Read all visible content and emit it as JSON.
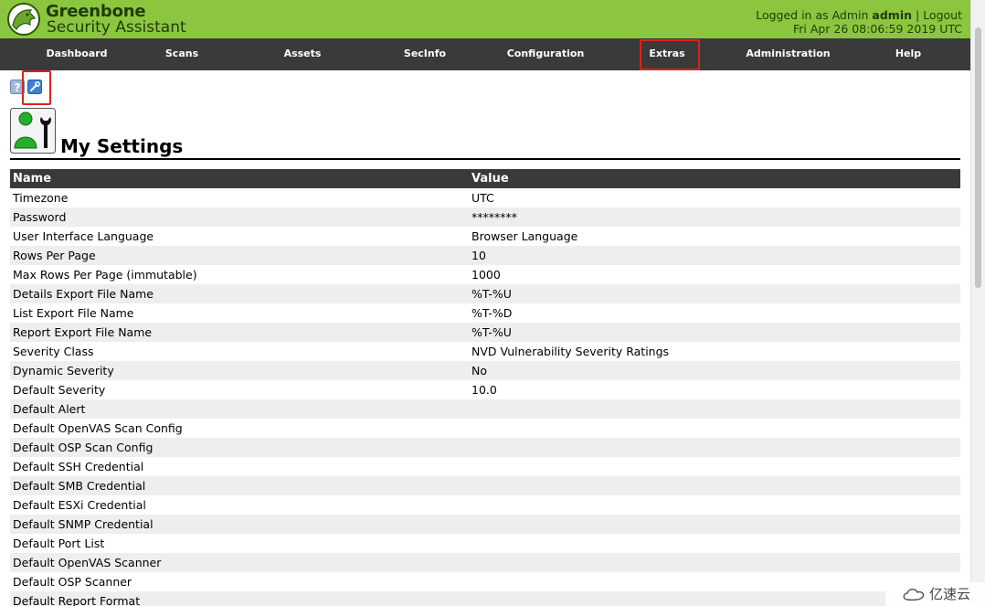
{
  "header": {
    "brand_line1": "Greenbone",
    "brand_line2": "Security Assistant",
    "logged_in_as": "Logged in as  Admin ",
    "username": "admin",
    "logout": "Logout",
    "separator": "|",
    "datetime": "Fri Apr 26 08:06:59 2019 UTC"
  },
  "nav": {
    "items": [
      {
        "label": "Dashboard"
      },
      {
        "label": "Scans"
      },
      {
        "label": "Assets"
      },
      {
        "label": "SecInfo"
      },
      {
        "label": "Configuration"
      },
      {
        "label": "Extras"
      },
      {
        "label": "Administration"
      },
      {
        "label": "Help"
      }
    ]
  },
  "toolbar": {
    "icons": [
      "help-icon",
      "edit-wrench-icon"
    ]
  },
  "page": {
    "title": "My Settings"
  },
  "table": {
    "headers": {
      "name": "Name",
      "value": "Value"
    },
    "rows": [
      {
        "name": "Timezone",
        "value": "UTC"
      },
      {
        "name": "Password",
        "value": "********"
      },
      {
        "name": "User Interface Language",
        "value": "Browser Language"
      },
      {
        "name": "Rows Per Page",
        "value": "10"
      },
      {
        "name": "Max Rows Per Page (immutable)",
        "value": "1000"
      },
      {
        "name": "Details Export File Name",
        "value": "%T-%U"
      },
      {
        "name": "List Export File Name",
        "value": "%T-%D"
      },
      {
        "name": "Report Export File Name",
        "value": "%T-%U"
      },
      {
        "name": "Severity Class",
        "value": "NVD Vulnerability Severity Ratings"
      },
      {
        "name": "Dynamic Severity",
        "value": "No"
      },
      {
        "name": "Default Severity",
        "value": "10.0"
      },
      {
        "name": "Default Alert",
        "value": ""
      },
      {
        "name": "Default OpenVAS Scan Config",
        "value": ""
      },
      {
        "name": "Default OSP Scan Config",
        "value": ""
      },
      {
        "name": "Default SSH Credential",
        "value": ""
      },
      {
        "name": "Default SMB Credential",
        "value": ""
      },
      {
        "name": "Default ESXi Credential",
        "value": ""
      },
      {
        "name": "Default SNMP Credential",
        "value": ""
      },
      {
        "name": "Default Port List",
        "value": ""
      },
      {
        "name": "Default OpenVAS Scanner",
        "value": ""
      },
      {
        "name": "Default OSP Scanner",
        "value": ""
      },
      {
        "name": "Default Report Format",
        "value": ""
      }
    ]
  },
  "watermark": {
    "text": "亿速云"
  },
  "colors": {
    "header_green": "#8cc63f",
    "nav_dark": "#3a3a3a",
    "highlight_red": "#e0201e",
    "row_alt": "#eeeeee"
  }
}
